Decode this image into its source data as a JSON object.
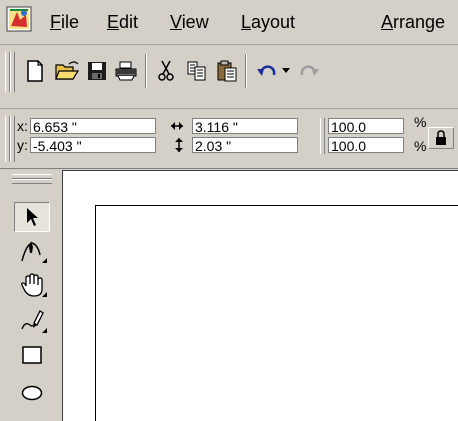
{
  "menu": {
    "items": [
      {
        "mnemonic": "F",
        "rest": "ile"
      },
      {
        "mnemonic": "E",
        "rest": "dit"
      },
      {
        "mnemonic": "V",
        "rest": "iew"
      },
      {
        "mnemonic": "L",
        "rest": "ayout"
      },
      {
        "mnemonic": "A",
        "rest": "rrange"
      }
    ]
  },
  "toolbar": {
    "buttons": [
      "new-icon",
      "open-icon",
      "save-icon",
      "print-icon",
      "cut-icon",
      "copy-icon",
      "paste-icon",
      "undo-icon",
      "undo-dropdown-icon",
      "redo-icon"
    ]
  },
  "property_bar": {
    "x_label": "x:",
    "x_value": "6.653 \"",
    "y_label": "y:",
    "y_value": "-5.403 \"",
    "width_value": "3.116 \"",
    "height_value": "2.03 \"",
    "scale_x": "100.0",
    "scale_y": "100.0",
    "percent_symbol": "%",
    "lock_icon": "lock-icon"
  },
  "toolbox": {
    "tools": [
      "pick-tool-icon",
      "shape-tool-icon",
      "pan-tool-icon",
      "freehand-tool-icon",
      "rectangle-tool-icon",
      "ellipse-tool-icon"
    ],
    "active_tool": "pick-tool-icon"
  },
  "colors": {
    "chrome": "#d4d0c8",
    "canvas": "#ffffff"
  }
}
